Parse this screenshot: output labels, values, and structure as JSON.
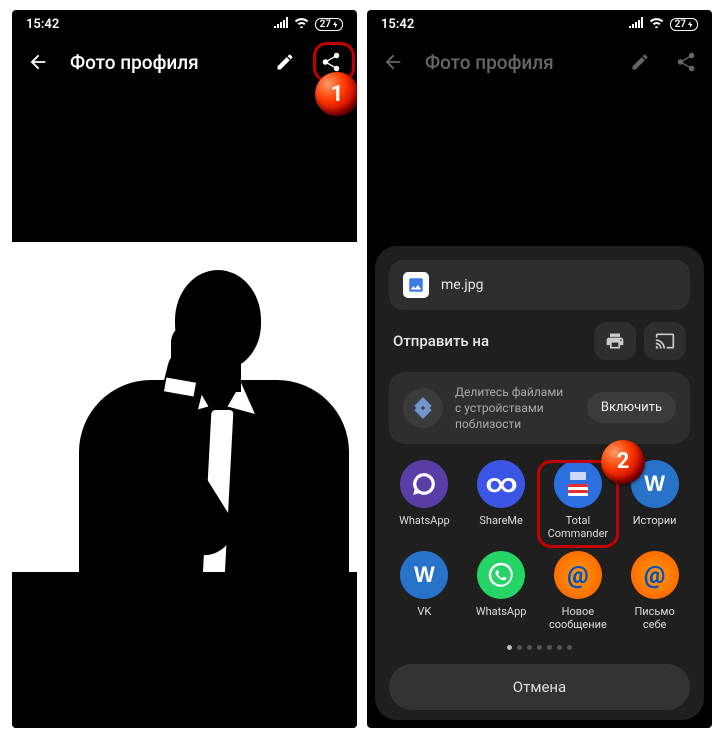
{
  "status": {
    "time": "15:42",
    "battery": "27"
  },
  "appbar": {
    "title": "Фото профиля"
  },
  "badges": {
    "one": "1",
    "two": "2"
  },
  "sheet": {
    "filename": "me.jpg",
    "send_title": "Отправить на",
    "nearby_line1": "Делитесь файлами",
    "nearby_line2": "с устройствами",
    "nearby_line3": "поблизости",
    "enable": "Включить",
    "cancel": "Отмена"
  },
  "apps": {
    "r1c1": "WhatsApp",
    "r1c2": "ShareMe",
    "r1c3": "Total\nCommander",
    "r1c4": "Истории",
    "r2c1": "VK",
    "r2c2": "WhatsApp",
    "r2c3": "Новое\nсообщение",
    "r2c4": "Письмо\nсебе"
  }
}
